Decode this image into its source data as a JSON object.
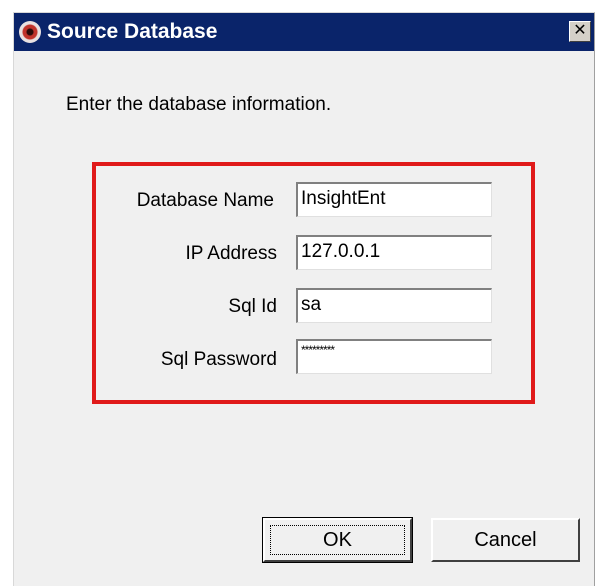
{
  "window": {
    "title": "Source Database",
    "icon": "database-eye-icon",
    "close_glyph": "✕"
  },
  "dialog": {
    "instructions": "Enter the database information."
  },
  "fields": [
    {
      "label": "Database Name",
      "value": "InsightEnt"
    },
    {
      "label": "IP Address",
      "value": "127.0.0.1"
    },
    {
      "label": "Sql Id",
      "value": "sa"
    },
    {
      "label": "Sql Password",
      "value": "*********"
    }
  ],
  "buttons": {
    "ok_label": "OK",
    "cancel_label": "Cancel"
  },
  "colors": {
    "titlebar": "#0a246a",
    "highlight_frame": "#e01a1a",
    "dialog_bg": "#f0f0f0"
  }
}
